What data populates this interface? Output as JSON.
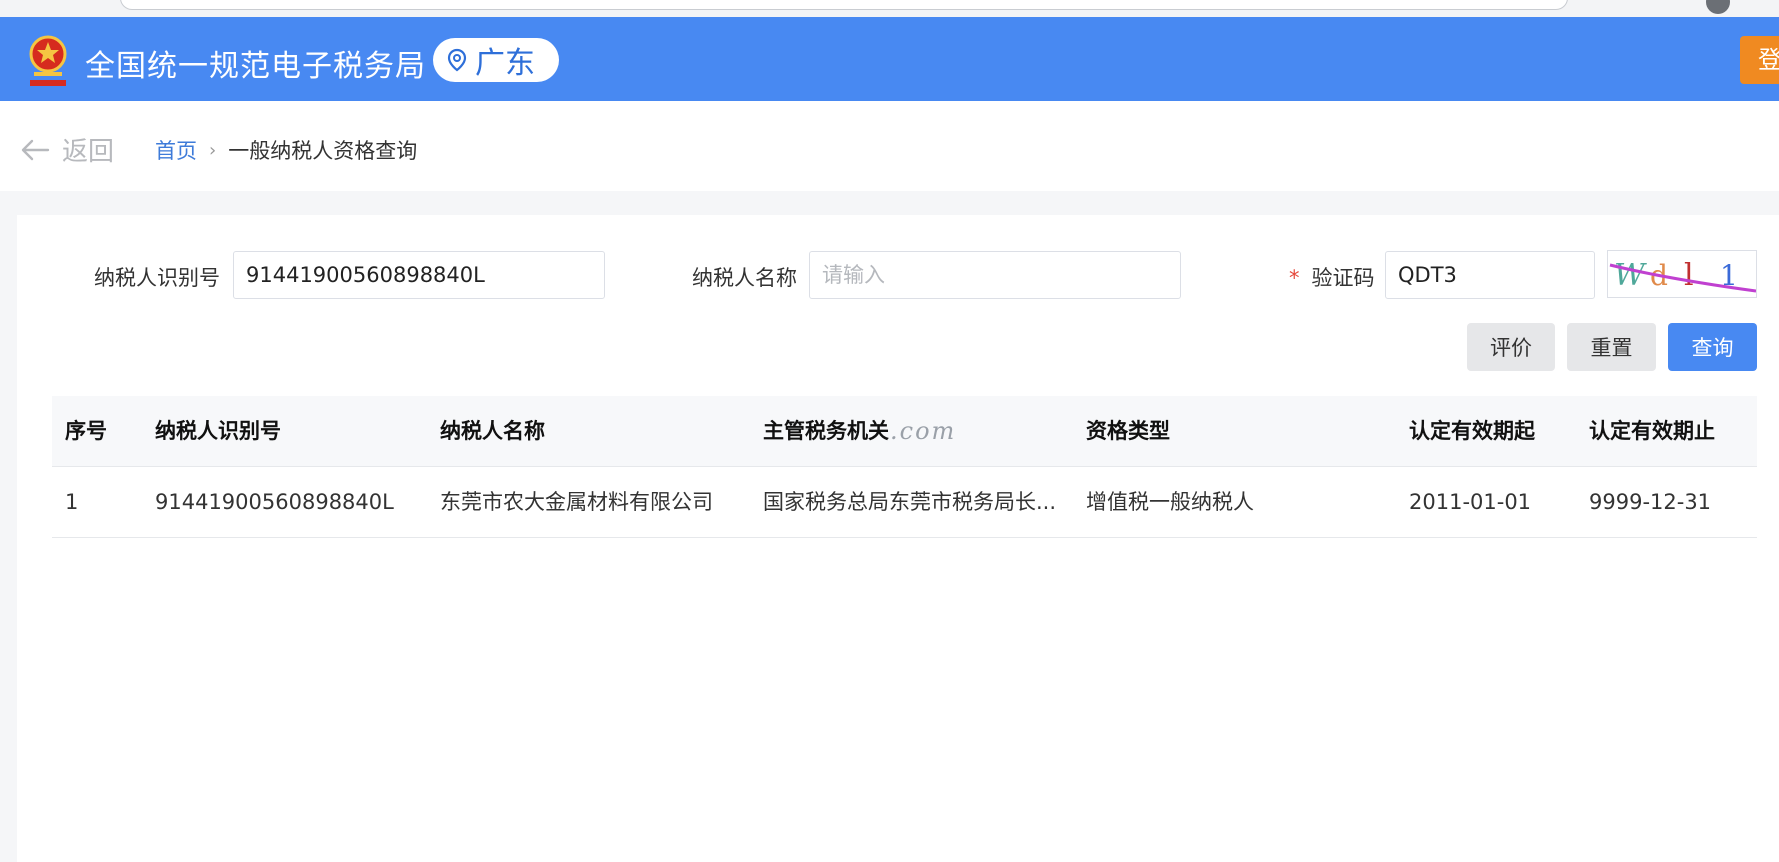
{
  "header": {
    "site_title": "全国统一规范电子税务局",
    "region": "广东",
    "login_label": "登",
    "colors": {
      "header_bg": "#4889f2",
      "login_bg": "#f08a21",
      "region_text": "#2e6fd9"
    }
  },
  "breadcrumb": {
    "back_label": "返回",
    "home_label": "首页",
    "separator": "›",
    "current_label": "一般纳税人资格查询"
  },
  "form": {
    "taxpayer_id_label": "纳税人识别号",
    "taxpayer_id_value": "91441900560898840L",
    "taxpayer_name_label": "纳税人名称",
    "taxpayer_name_placeholder": "请输入",
    "captcha_required_mark": "*",
    "captcha_label": "验证码",
    "captcha_value": "QDT3",
    "captcha_image_text": "Wdl1"
  },
  "actions": {
    "rate_label": "评价",
    "reset_label": "重置",
    "query_label": "查询"
  },
  "table": {
    "columns": [
      "序号",
      "纳税人识别号",
      "纳税人名称",
      "主管税务机关",
      "资格类型",
      "认定有效期起",
      "认定有效期止"
    ],
    "rows": [
      [
        "1",
        "91441900560898840L",
        "东莞市农大金属材料有限公司",
        "国家税务总局东莞市税务局长...",
        "增值税一般纳税人",
        "2011-01-01",
        "9999-12-31"
      ]
    ],
    "watermark": ".com"
  }
}
